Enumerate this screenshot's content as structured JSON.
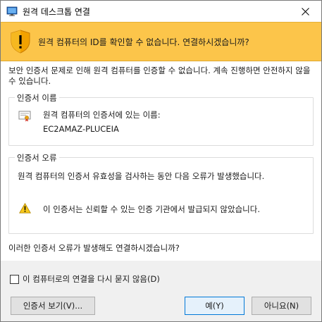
{
  "window": {
    "title": "원격 데스크톱 연결",
    "title_icon": "remote-desktop-icon",
    "close_icon": "close-icon"
  },
  "banner": {
    "icon": "shield-warning-icon",
    "text": "원격 컴퓨터의 ID를 확인할 수 없습니다. 연결하시겠습니까?",
    "color": "#fcc54a"
  },
  "intro_text": "보안 인증서 문제로 인해 원격 컴퓨터를 인증할 수 없습니다. 계속 진행하면 안전하지 않을 수 있습니다.",
  "certificate_group": {
    "title": "인증서 이름",
    "label": "원격 컴퓨터의 인증서에 있는 이름:",
    "name": "EC2AMAZ-PLUCEIA"
  },
  "error_group": {
    "title": "인증서 오류",
    "description": "원격 컴퓨터의 인증서 유효성을 검사하는 동안 다음 오류가 발생했습니다.",
    "warning": "이 인증서는 신뢰할 수 있는 인증 기관에서 발급되지 않았습니다."
  },
  "question": "이러한 인증서 오류가 발생해도 연결하시겠습니까?",
  "checkbox": {
    "label": "이 컴퓨터로의 연결을 다시 묻지 않음(D)",
    "checked": false
  },
  "buttons": {
    "view_certificate": "인증서 보기(V)...",
    "yes": "예(Y)",
    "no": "아니요(N)"
  }
}
